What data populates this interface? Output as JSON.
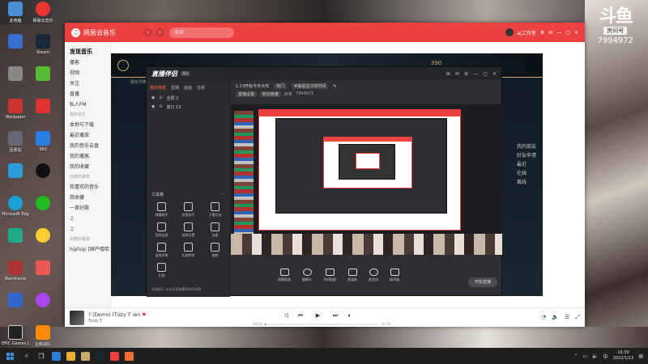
{
  "watermark": {
    "logo": "斗鱼",
    "tag": "房间号",
    "room": "7994972"
  },
  "desktop_icons": {
    "col1": [
      "此电脑",
      "Microsoft Edge",
      "",
      "Wallpaper",
      "回收站",
      "",
      "Microsoft Edge",
      "",
      "Mainframe",
      "",
      "EPIC Games Launcher"
    ],
    "col2": [
      "网易云音乐",
      "Steam",
      "",
      "",
      "360",
      "",
      "",
      "",
      "",
      "",
      "企鹅战队"
    ],
    "col3": [
      "",
      "",
      "",
      "",
      "",
      "",
      "",
      "",
      "",
      "",
      "",
      ""
    ]
  },
  "netease": {
    "title": "网易云音乐",
    "search_placeholder": "搜索",
    "user": "aj工作室",
    "sidebar": {
      "items_top": [
        "发现音乐",
        "播客",
        "视频",
        "关注",
        "直播",
        "私人FM"
      ],
      "head_mine": "我的音乐",
      "items_mine": [
        "本地与下载",
        "最近播放",
        "我的音乐云盘",
        "我的播客",
        "我的收藏"
      ],
      "head_created": "创建的歌单",
      "items_created": [
        "我喜欢的音乐",
        "我收藏",
        "一首好歌",
        "♫",
        "♫"
      ],
      "head_fav": "收藏的歌单",
      "items_fav": [
        "hiphop [国产嘻哈]"
      ]
    },
    "player": {
      "song": "? (Demo) (Tizzy T ren",
      "artist": "Tizzy T",
      "time_current": "00:02",
      "time_total": "03:46",
      "progress": 0.01
    }
  },
  "game": {
    "coin": "390",
    "subtext": "朋友列表",
    "list": [
      "我的朋友",
      "好友申请",
      "最近",
      "在线",
      "离线"
    ]
  },
  "stream_app": {
    "brand": "直播伴侣",
    "version": "测试",
    "tabs": [
      "我的场景",
      "直播",
      "画面",
      "音频"
    ],
    "scenes": [
      "全屏 2",
      "窗口 13"
    ],
    "tools_title": "工具箱",
    "tools": [
      "弹幕助手",
      "房管助手",
      "主播任务",
      "视频连麦",
      "录屏设置",
      "连麦",
      "虚拟形象",
      "礼物特效",
      "美颜",
      "礼物"
    ],
    "title_line": "1.13开始今天大鸡",
    "tag": "热门",
    "category": "#抽屉宝冷却时间",
    "room_chip": "直播设置",
    "stat_chip": "粉丝数量",
    "stat2": "房管",
    "id": "7994972",
    "bottom_buttons": [
      "直播画面",
      "摄像头",
      "手机投屏",
      "多媒体",
      "麦克风",
      "扬声器"
    ],
    "start_button": "开始直播",
    "footer": "礼物提示  点击发送弹幕和房间消息"
  },
  "taskbar": {
    "time": "16:39",
    "date": "2022/1/13"
  },
  "colors": {
    "netease_red": "#ec4141",
    "stream_orange": "#ff6a2f",
    "lol_gold": "#c8aa6e"
  }
}
